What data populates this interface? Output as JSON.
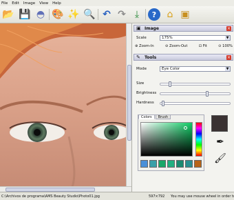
{
  "menu": [
    "File",
    "Edit",
    "Image",
    "View",
    "Help"
  ],
  "toolbar": {
    "icons": [
      "open-folder-icon",
      "save-icon",
      "adjust-icon",
      "palette-icon",
      "magic-wand-icon",
      "zoom-page-icon",
      "undo-icon",
      "redo-icon",
      "export-icon",
      "help-icon",
      "home-icon",
      "box-icon"
    ],
    "glyphs": [
      "📂",
      "💾",
      "◓",
      "🎨",
      "✨",
      "🔍",
      "↶",
      "↷",
      "⤓",
      "?",
      "⌂",
      "▣"
    ]
  },
  "image_panel": {
    "title": "Image",
    "scale_label": "Scale",
    "scale_value": "175%",
    "zoom_in": "Zoom-In",
    "zoom_out": "Zoom-Out",
    "fit": "Fit",
    "hundred": "100%"
  },
  "tools_panel": {
    "title": "Tools",
    "mode_label": "Mode",
    "mode_value": "Eye Color",
    "size_label": "Size",
    "brightness_label": "Brightness",
    "hardness_label": "Hardness",
    "size_level": 0.12,
    "brightness_level": 0.68,
    "hardness_level": 0.02
  },
  "color_picker": {
    "tabs": [
      "Colors",
      "Brush"
    ],
    "active_tab": "Colors",
    "base_hue": "#11cc66",
    "current_color": "#3a3232",
    "swatches": [
      "#4a8fd8",
      "#3aa0a8",
      "#1aa868",
      "#22b080",
      "#1a8a70",
      "#2a9090",
      "#b86418"
    ]
  },
  "status": {
    "path": "C:\\Archivos de programa\\AMS Beauty Studio\\Photo01.jpg",
    "dimensions": "597×792",
    "hint": "You may use mouse wheel in order to zoom"
  }
}
